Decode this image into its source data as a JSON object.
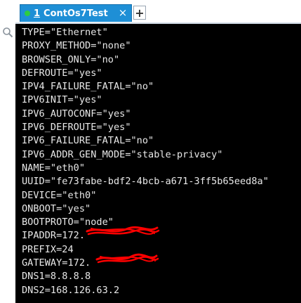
{
  "tab": {
    "number": "1",
    "title": "ContOs7Test",
    "close_glyph": "×",
    "status_color": "#2ecc40"
  },
  "add_tab_glyph": "+",
  "terminal": {
    "lines": [
      "TYPE=\"Ethernet\"",
      "PROXY_METHOD=\"none\"",
      "BROWSER_ONLY=\"no\"",
      "DEFROUTE=\"yes\"",
      "IPV4_FAILURE_FATAL=\"no\"",
      "IPV6INIT=\"yes\"",
      "IPV6_AUTOCONF=\"yes\"",
      "IPV6_DEFROUTE=\"yes\"",
      "IPV6_FAILURE_FATAL=\"no\"",
      "IPV6_ADDR_GEN_MODE=\"stable-privacy\"",
      "NAME=\"eth0\"",
      "UUID=\"fe73fabe-bdf2-4bcb-a671-3ff5b65eed8a\"",
      "DEVICE=\"eth0\"",
      "ONBOOT=\"yes\"",
      "BOOTPROTO=\"node\"",
      "IPADDR=172.",
      "PREFIX=24",
      "GATEWAY=172.",
      "DNS1=8.8.8.8",
      "DNS2=168.126.63.2"
    ]
  },
  "icons": {
    "left_tool": "search-icon",
    "status": "status-dot-icon"
  },
  "colors": {
    "tab_bg": "#1e8fd6",
    "terminal_bg": "#000000",
    "terminal_fg": "#e8e8e8",
    "redaction": "#ff0000"
  }
}
